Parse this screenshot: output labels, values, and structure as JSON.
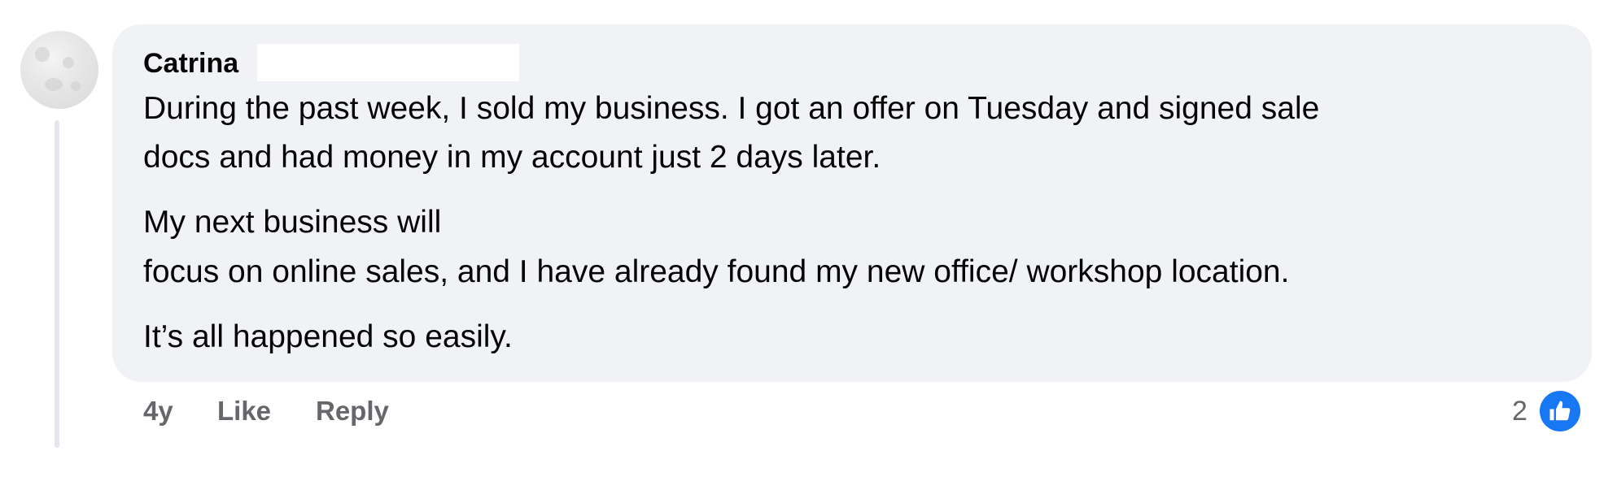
{
  "comment": {
    "author": "Catrina",
    "paragraphs": {
      "p1_line1": "During the past week, I sold my business. I got an offer on Tuesday and signed sale",
      "p1_line2": "docs and had money in my account just 2 days later.",
      "p2_line1": "My next business will",
      "p2_line2": "focus on online sales, and I have already found my new office/ workshop location.",
      "p3_line1": "It’s all happened so easily."
    },
    "actions": {
      "age": "4y",
      "like": "Like",
      "reply": "Reply"
    },
    "reactions": {
      "count": "2",
      "icon": "thumbs-up-icon",
      "color": "#1877f2"
    }
  },
  "colors": {
    "bubble": "#f0f2f5",
    "secondary_text": "#65676b",
    "primary_text": "#050505",
    "accent": "#1877f2"
  }
}
